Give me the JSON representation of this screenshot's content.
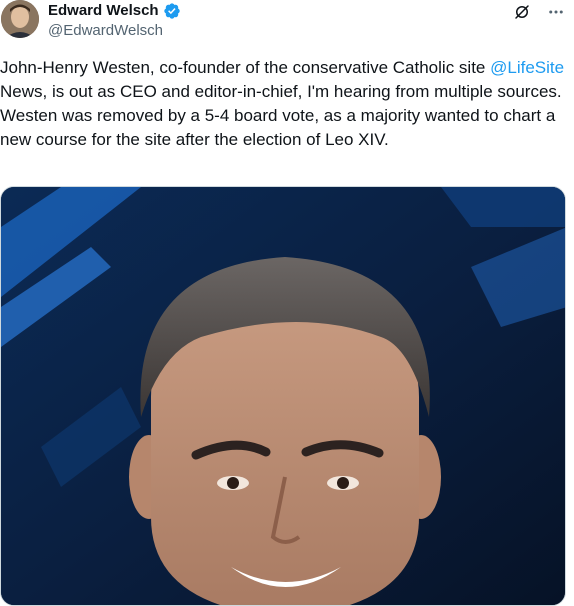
{
  "author": {
    "display_name": "Edward Welsch",
    "handle": "@EdwardWelsch",
    "verified": true
  },
  "tweet": {
    "text_before": "John-Henry Westen, co-founder of the conservative Catholic site ",
    "mention": "@LifeSite",
    "text_after": " News, is out as CEO and editor-in-chief, I'm hearing from multiple sources. Westen was removed by a 5-4 board vote, as a majority wanted to chart a new course for the site after the election of Leo XIV."
  },
  "icons": {
    "grok": "grok-icon",
    "more": "more-icon",
    "verified": "verified-badge-icon"
  },
  "colors": {
    "accent": "#1d9bf0",
    "text": "#0f1419",
    "secondary": "#536471"
  }
}
